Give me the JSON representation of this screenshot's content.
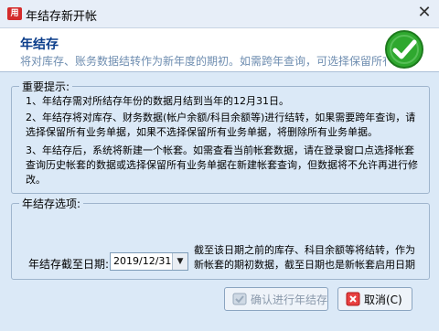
{
  "window": {
    "title": "年结存新开帐",
    "close_glyph": "✕",
    "app_icon_text": "用"
  },
  "header": {
    "title": "年结存",
    "subtitle": "将对库存、账务数据结转作为新年度的期初。如需跨年查询，可选择保留所有单据"
  },
  "notes": {
    "label": "重要提示:",
    "line1": "1、年结存需对所结存年份的数据月结到当年的12月31日。",
    "line2": "2、年结存将对库存、财务数据(帐户余额/科目余额等)进行结转，如果需要跨年查询，请选择保留所有业务单据，如果不选择保留所有业务单据，将删除所有业务单据。",
    "line3": "3、年结存后，系统将新建一个帐套。如需查看当前帐套数据，请在登录窗口点选择帐套查询历史帐套的数据或选择保留所有业务单据在新建帐套查询，但数据将不允许再进行修改。"
  },
  "options": {
    "label": "年结存选项:",
    "date_label": "年结存截至日期:",
    "date_value": "2019/12/31",
    "description": "截至该日期之前的库存、科目余额等将结转，作为新帐套的期初数据，截至日期也是新帐套启用日期"
  },
  "buttons": {
    "confirm": "确认进行年结存",
    "cancel": "取消(C)"
  },
  "colors": {
    "accent": "#0a3c8a",
    "check_green": "#2fa82f",
    "cancel_red": "#cc2020"
  },
  "icons": {
    "app": "app-icon",
    "check": "check-circle-icon",
    "confirm": "confirm-icon",
    "cancel": "cancel-icon",
    "dropdown": "chevron-down-icon"
  }
}
